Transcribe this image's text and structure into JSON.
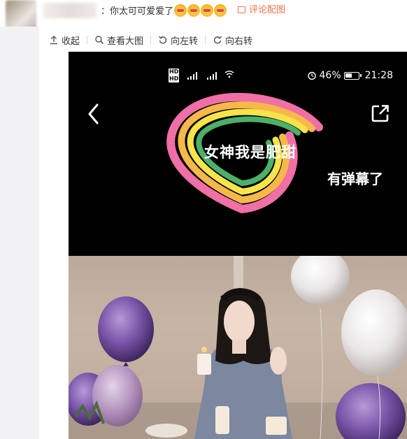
{
  "comment": {
    "text": "：你太可可爱爱了",
    "emoji": [
      "grinning-face",
      "grinning-face",
      "grinning-face",
      "grinning-face"
    ],
    "pic_link": "评论配图"
  },
  "toolbar": {
    "collapse": "收起",
    "view_large": "查看大图",
    "rotate_left": "向左转",
    "rotate_right": "向右转"
  },
  "image": {
    "status": {
      "sim1": "HD",
      "sim2": "HD",
      "battery": "46%",
      "time": "21:28"
    },
    "caption": "女神我是肥甜",
    "danmaku": "有弹幕了"
  },
  "colors": {
    "accent": "#eb7350",
    "gutter": "#f2f2f5",
    "rainbow": [
      "#f06fa6",
      "#f6b84a",
      "#f6e44a",
      "#4cb06a"
    ]
  }
}
